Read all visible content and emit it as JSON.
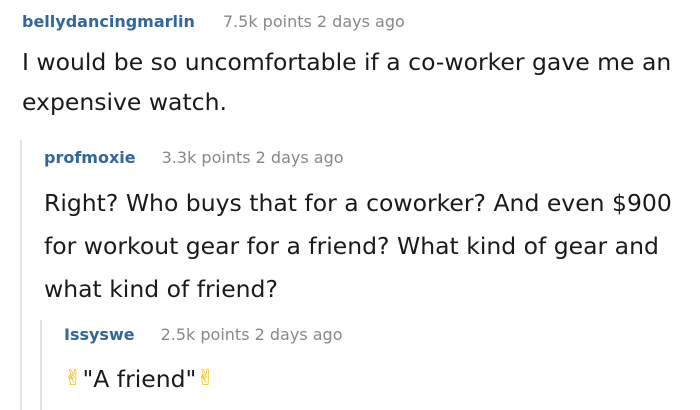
{
  "comments": [
    {
      "author": "bellydancingmarlin",
      "points": "7.5k points",
      "time": "2 days ago",
      "body": "I would be so uncomfortable if a co-worker gave me an expensive watch."
    },
    {
      "author": "profmoxie",
      "points": "3.3k points",
      "time": "2 days ago",
      "body": "Right? Who buys that for a coworker? And even $900 for workout gear for a friend? What kind of gear and what kind of friend?"
    },
    {
      "author": "Issyswe",
      "points": "2.5k points",
      "time": "2 days ago",
      "body": "\"A friend\"",
      "icon_before": "victory-hand-icon",
      "icon_after": "victory-hand-icon"
    }
  ],
  "colors": {
    "author": "#336699",
    "meta": "#888888",
    "text": "#1a1a1b",
    "thread_line": "#e2e2e2"
  }
}
